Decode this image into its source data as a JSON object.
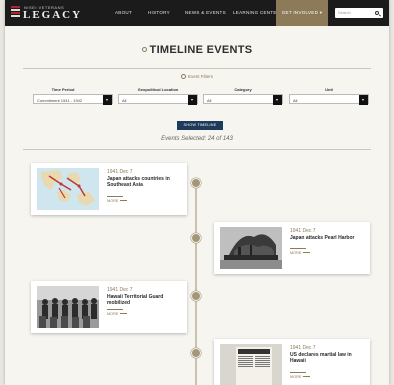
{
  "nav": {
    "logo_small": "NISEI VETERANS",
    "logo_big": "LEGACY",
    "items": [
      "ABOUT",
      "HISTORY",
      "NEWS & EVENTS",
      "LEARNING CENTER"
    ],
    "get_involved": "GET INVOLVED ▾",
    "search_placeholder": "Search"
  },
  "header": {
    "title": "TIMELINE EVENTS",
    "filters_toggle": "Event Filters"
  },
  "filters": [
    {
      "label": "Time Period",
      "value": "Commitment 1941 - 1942"
    },
    {
      "label": "Geopolitical Location",
      "value": "All"
    },
    {
      "label": "Category",
      "value": "All"
    },
    {
      "label": "Unit",
      "value": "All"
    }
  ],
  "show_button": "SHOW TIMELINE",
  "selected_text": "Events Selected: 24 of 143",
  "events": [
    {
      "date": "1941 Dec 7",
      "title": "Japan attacks countries in Southeast Asia",
      "more": "MORE",
      "side": "left",
      "thumb": "map"
    },
    {
      "date": "1941 Dec 7",
      "title": "Japan attacks Pearl Harbor",
      "more": "MORE",
      "side": "right",
      "thumb": "ship"
    },
    {
      "date": "1941 Dec 7",
      "title": "Hawaii Territorial Guard mobilized",
      "more": "MORE",
      "side": "left",
      "thumb": "troops"
    },
    {
      "date": "1941 Dec 7",
      "title": "US declares martial law in Hawaii",
      "more": "MORE",
      "side": "right",
      "thumb": "newspaper"
    }
  ],
  "colors": {
    "nav_bg": "#1b1b1b",
    "accent_gold": "#8c7a59",
    "button_navy": "#1f3b5c",
    "page_bg": "#f7f5f0"
  }
}
